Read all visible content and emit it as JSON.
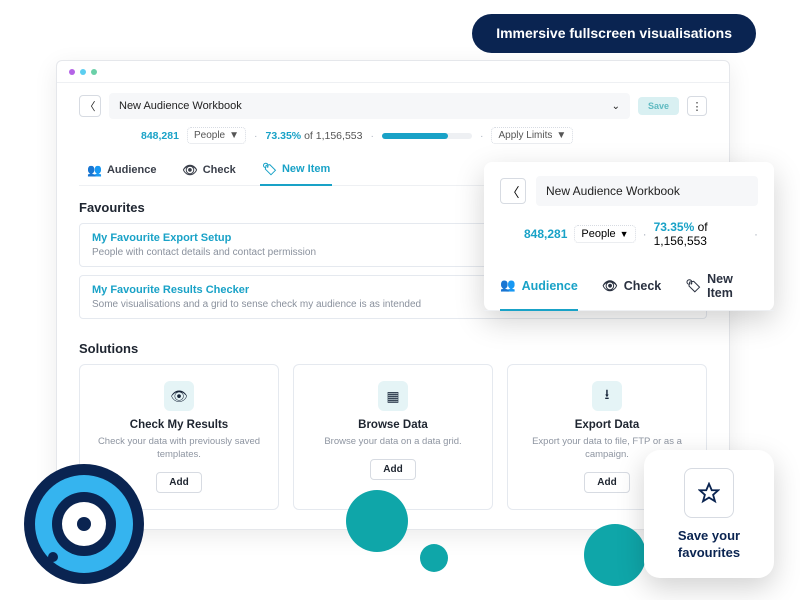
{
  "promo_badge": "Immersive fullscreen visualisations",
  "workbook": {
    "title": "New Audience Workbook",
    "save_label": "Save"
  },
  "metrics": {
    "count": "848,281",
    "unit_label": "People",
    "percent": "73.35%",
    "of_label": "of",
    "total": "1,156,553",
    "limits_label": "Apply Limits"
  },
  "tabs": {
    "audience": "Audience",
    "check": "Check",
    "new_item": "New Item"
  },
  "sections": {
    "favourites": "Favourites",
    "solutions": "Solutions"
  },
  "favourites": [
    {
      "title": "My Favourite Export Setup",
      "sub": "People with contact details and contact permission"
    },
    {
      "title": "My Favourite Results Checker",
      "sub": "Some visualisations and a grid to sense check my audience is as intended"
    }
  ],
  "solutions": {
    "check": {
      "title": "Check My Results",
      "sub": "Check your data with previously saved templates.",
      "add": "Add"
    },
    "browse": {
      "title": "Browse Data",
      "sub": "Browse your data on a data grid.",
      "add": "Add"
    },
    "export": {
      "title": "Export Data",
      "sub": "Export your data to file, FTP or as a campaign.",
      "add": "Add"
    }
  },
  "popout": {
    "title": "New Audience Workbook",
    "count": "848,281",
    "unit_label": "People",
    "percent": "73.35%",
    "of_label": "of",
    "total": "1,156,553",
    "tab_audience": "Audience",
    "tab_check": "Check",
    "tab_new": "New Item"
  },
  "fav_card": "Save your favourites"
}
